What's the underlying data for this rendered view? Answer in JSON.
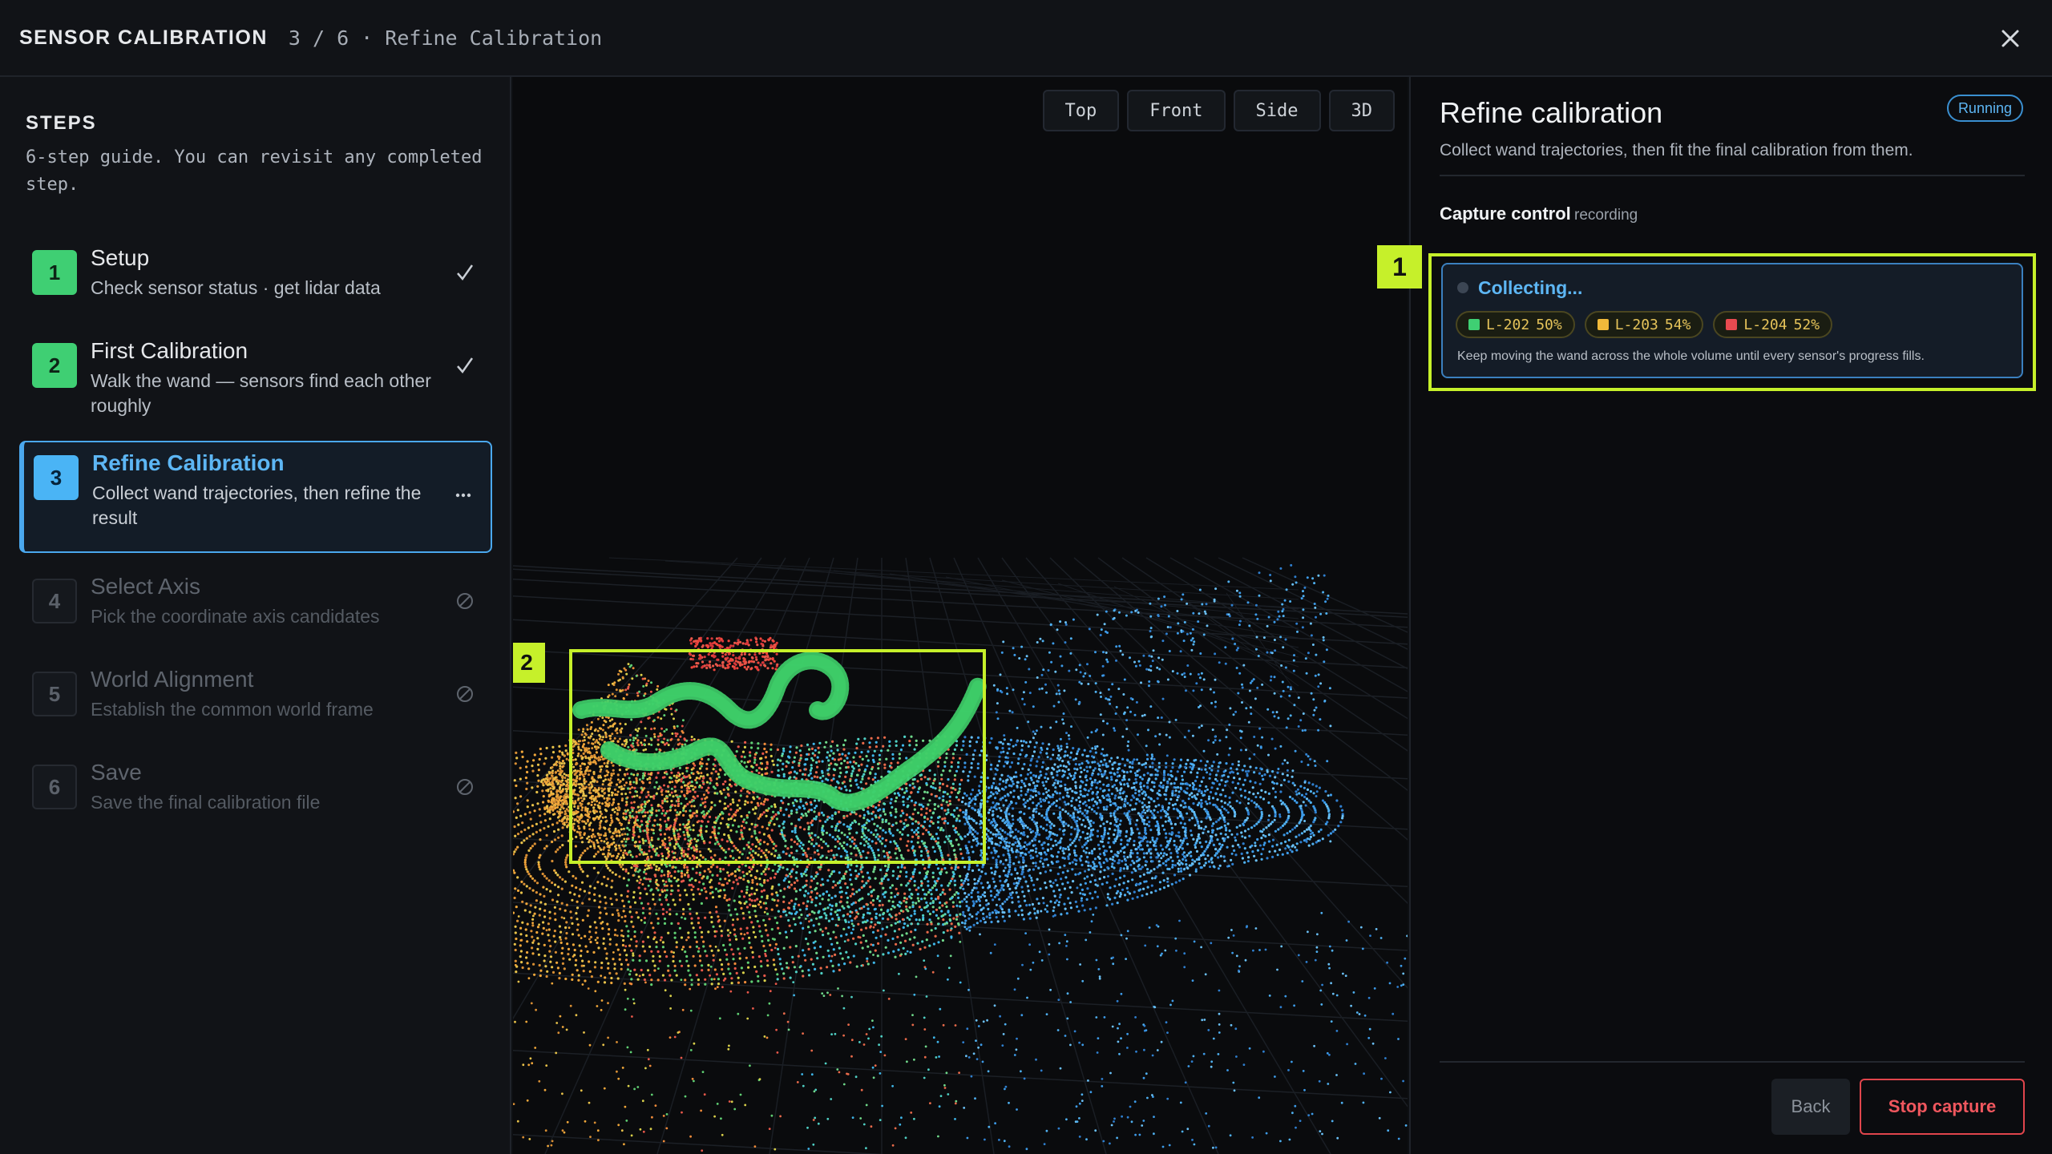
{
  "header": {
    "title": "SENSOR CALIBRATION",
    "crumb": "3 / 6 · Refine Calibration"
  },
  "sidebar": {
    "heading": "STEPS",
    "description": "6-step guide. You can revisit any completed step.",
    "steps": [
      {
        "num": "1",
        "title": "Setup",
        "sub": "Check sensor status · get lidar data",
        "state": "done"
      },
      {
        "num": "2",
        "title": "First Calibration",
        "sub": "Walk the wand — sensors find each other roughly",
        "state": "done"
      },
      {
        "num": "3",
        "title": "Refine Calibration",
        "sub": "Collect wand trajectories, then refine the result",
        "state": "active"
      },
      {
        "num": "4",
        "title": "Select Axis",
        "sub": "Pick the coordinate axis candidates",
        "state": "locked"
      },
      {
        "num": "5",
        "title": "World Alignment",
        "sub": "Establish the common world frame",
        "state": "locked"
      },
      {
        "num": "6",
        "title": "Save",
        "sub": "Save the final calibration file",
        "state": "locked"
      }
    ]
  },
  "viewport": {
    "tabs": [
      "Top",
      "Front",
      "Side",
      "3D"
    ],
    "annotation_label": "2"
  },
  "panel": {
    "title": "Refine calibration",
    "status": "Running",
    "description": "Collect wand trajectories, then fit the final calibration from them.",
    "capture_title": "Capture control",
    "capture_state": "recording",
    "annotation_label": "1",
    "card": {
      "title": "Collecting...",
      "chips": [
        {
          "id": "L-202",
          "pct": "50%",
          "color": "#3fcf73"
        },
        {
          "id": "L-203",
          "pct": "54%",
          "color": "#f0b93a"
        },
        {
          "id": "L-204",
          "pct": "52%",
          "color": "#e84a50"
        }
      ],
      "note": "Keep moving the wand across the whole volume until every sensor's progress fills."
    },
    "back_label": "Back",
    "stop_label": "Stop capture"
  },
  "colors": {
    "accent": "#4aa8ee",
    "done": "#3fcf73",
    "annotation": "#c6f02a",
    "danger": "#e0454c"
  }
}
